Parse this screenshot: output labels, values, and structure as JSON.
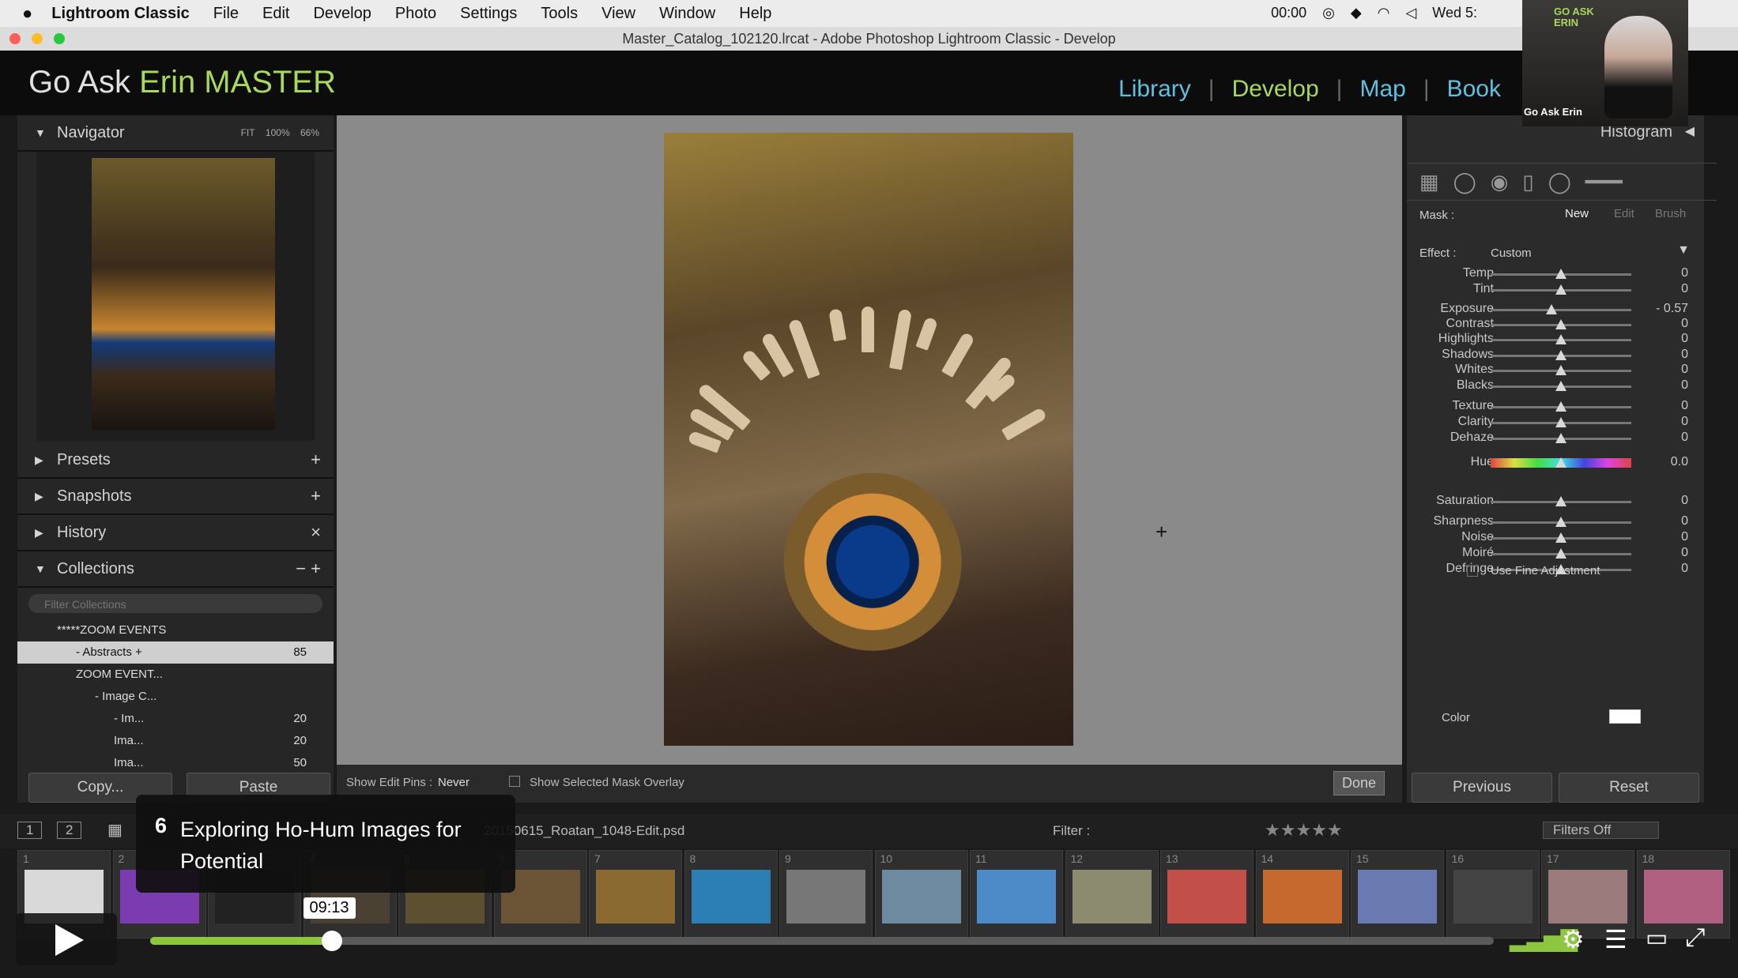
{
  "menubar": {
    "app": "Lightroom Classic",
    "items": [
      "File",
      "Edit",
      "Develop",
      "Photo",
      "Settings",
      "Tools",
      "View",
      "Window",
      "Help"
    ],
    "clock": "00:00",
    "date": "Wed 5:"
  },
  "window_title": "Master_Catalog_102120.lrcat - Adobe Photoshop Lightroom Classic - Develop",
  "identity": {
    "part1": "Go Ask ",
    "part2": "Erin MASTER"
  },
  "modules": [
    {
      "label": "Library",
      "active": false
    },
    {
      "label": "Develop",
      "active": true
    },
    {
      "label": "Map",
      "active": false
    },
    {
      "label": "Book",
      "active": false
    }
  ],
  "navigator": {
    "title": "Navigator",
    "zoom": [
      "FIT",
      "100%",
      "66%"
    ]
  },
  "panels": {
    "presets": "Presets",
    "snapshots": "Snapshots",
    "history": "History",
    "collections": "Collections",
    "filter_placeholder": "Filter Collections"
  },
  "collections": [
    {
      "label": "*****ZOOM EVENTS",
      "count": "",
      "indent": 0,
      "selected": false
    },
    {
      "label": "- Abstracts +",
      "count": "85",
      "indent": 1,
      "selected": true
    },
    {
      "label": "ZOOM EVENT...",
      "count": "",
      "indent": 1,
      "selected": false
    },
    {
      "label": "- Image C...",
      "count": "",
      "indent": 2,
      "selected": false
    },
    {
      "label": "- Im...",
      "count": "20",
      "indent": 3,
      "selected": false
    },
    {
      "label": "Ima...",
      "count": "20",
      "indent": 3,
      "selected": false
    },
    {
      "label": "Ima...",
      "count": "50",
      "indent": 3,
      "selected": false
    }
  ],
  "left_buttons": {
    "copy": "Copy...",
    "paste": "Paste"
  },
  "center_toolbar": {
    "show_pins_label": "Show Edit Pins :",
    "show_pins_value": "Never",
    "overlay_label": "Show Selected Mask Overlay",
    "done": "Done"
  },
  "right": {
    "histogram": "Histogram",
    "mask_label": "Mask :",
    "mask_new": "New",
    "mask_edit": "Edit",
    "mask_brush": "Brush",
    "effect_label": "Effect :",
    "effect_value": "Custom",
    "use_fine": "Use Fine Adjustment",
    "color_label": "Color",
    "previous": "Previous",
    "reset": "Reset"
  },
  "sliders": [
    {
      "label": "Temp",
      "value": "0",
      "pos": 0.5
    },
    {
      "label": "Tint",
      "value": "0",
      "pos": 0.5
    },
    {
      "label": "Exposure",
      "value": "- 0.57",
      "pos": 0.43
    },
    {
      "label": "Contrast",
      "value": "0",
      "pos": 0.5
    },
    {
      "label": "Highlights",
      "value": "0",
      "pos": 0.5
    },
    {
      "label": "Shadows",
      "value": "0",
      "pos": 0.5
    },
    {
      "label": "Whites",
      "value": "0",
      "pos": 0.5
    },
    {
      "label": "Blacks",
      "value": "0",
      "pos": 0.5
    },
    {
      "label": "Texture",
      "value": "0",
      "pos": 0.5
    },
    {
      "label": "Clarity",
      "value": "0",
      "pos": 0.5
    },
    {
      "label": "Dehaze",
      "value": "0",
      "pos": 0.5
    },
    {
      "label": "Hue",
      "value": "0.0",
      "pos": 0.5
    },
    {
      "label": "Saturation",
      "value": "0",
      "pos": 0.5
    },
    {
      "label": "Sharpness",
      "value": "0",
      "pos": 0.5
    },
    {
      "label": "Noise",
      "value": "0",
      "pos": 0.5
    },
    {
      "label": "Moiré",
      "value": "0",
      "pos": 0.5
    },
    {
      "label": "Defringe",
      "value": "0",
      "pos": 0.5
    }
  ],
  "filmbar": {
    "view1": "1",
    "view2": "2",
    "filename": "20150615_Roatan_1048-Edit.psd",
    "filter_label": "Filter :",
    "filters_off": "Filters Off"
  },
  "filmstrip": [
    "1",
    "2",
    "3",
    "4",
    "5",
    "6",
    "7",
    "8",
    "9",
    "10",
    "11",
    "12",
    "13",
    "14",
    "15",
    "16",
    "17",
    "18"
  ],
  "chapter": {
    "number": "6",
    "title": "Exploring Ho-Hum Images for Potential"
  },
  "player": {
    "time": "09:13",
    "progress": 0.135
  },
  "webcam": {
    "brand": "GO ASK ERIN",
    "name": "Go Ask Erin"
  }
}
